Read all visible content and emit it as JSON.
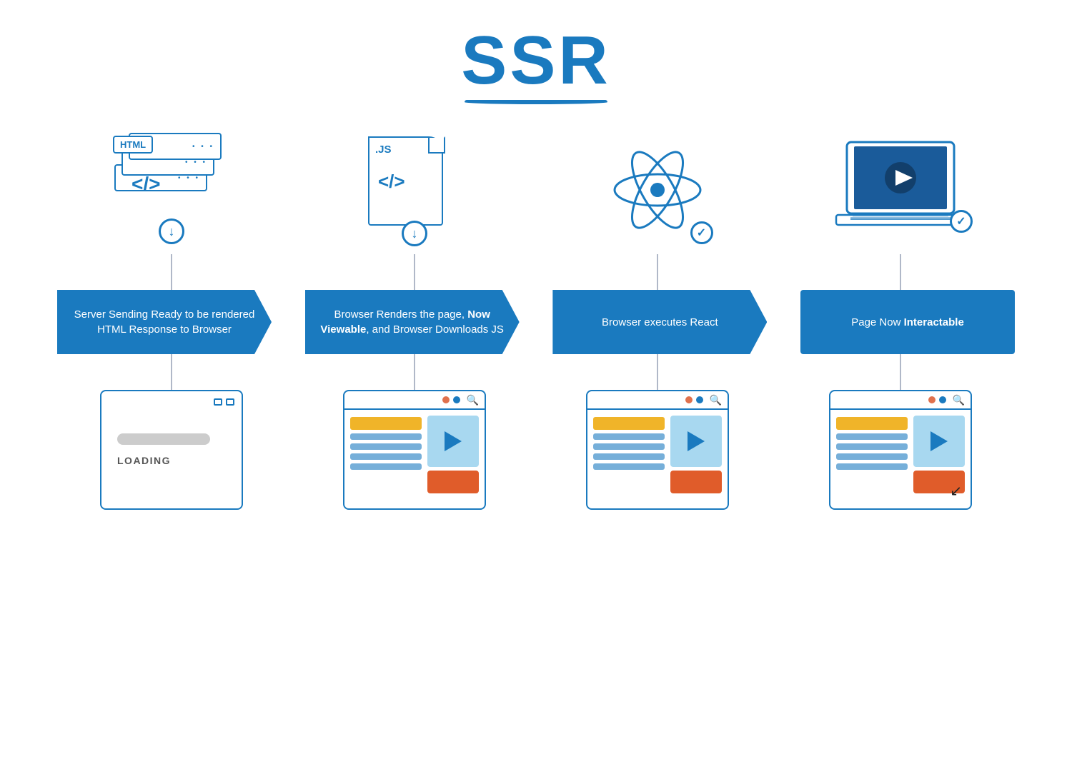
{
  "title": "SSR",
  "diagram": {
    "columns": [
      {
        "id": "col1",
        "icon_type": "html-stack",
        "box_label": "Server Sending Ready to be rendered HTML Response to Browser",
        "box_bold": null,
        "bottom_type": "loading"
      },
      {
        "id": "col2",
        "icon_type": "js-file",
        "box_label": "Browser Renders the page, Now Viewable, and Browser Downloads JS",
        "box_bold": "Now Viewable",
        "bottom_type": "browser"
      },
      {
        "id": "col3",
        "icon_type": "react-atom",
        "box_label": "Browser executes React",
        "box_bold": null,
        "bottom_type": "browser"
      },
      {
        "id": "col4",
        "icon_type": "laptop",
        "box_label": "Page Now Interactable",
        "box_bold": "Interactable",
        "bottom_type": "browser-cursor"
      }
    ]
  },
  "loading_text": "LOADING"
}
